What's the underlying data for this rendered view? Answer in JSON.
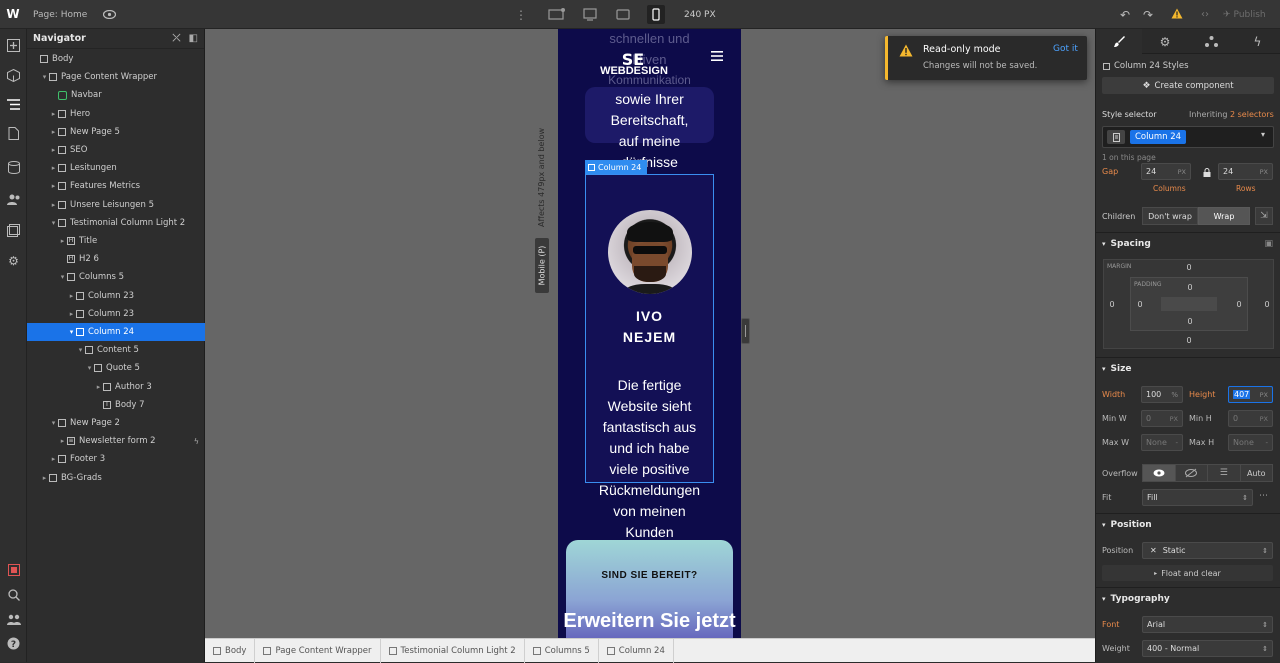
{
  "topbar": {
    "logo": "W",
    "page_label": "Page:",
    "page_name": "Home",
    "breakpoint_width": "240 PX",
    "publish_label": "Publish"
  },
  "navigator": {
    "title": "Navigator",
    "items": [
      {
        "label": "Body",
        "depth": 0,
        "arrow": "",
        "icon": "box"
      },
      {
        "label": "Page Content Wrapper",
        "depth": 1,
        "arrow": "▾",
        "icon": "box"
      },
      {
        "label": "Navbar",
        "depth": 2,
        "arrow": "",
        "icon": "symbol"
      },
      {
        "label": "Hero",
        "depth": 2,
        "arrow": "▸",
        "icon": "box"
      },
      {
        "label": "New Page 5",
        "depth": 2,
        "arrow": "▸",
        "icon": "box"
      },
      {
        "label": "SEO",
        "depth": 2,
        "arrow": "▸",
        "icon": "box"
      },
      {
        "label": "Lesitungen",
        "depth": 2,
        "arrow": "▸",
        "icon": "box"
      },
      {
        "label": "Features Metrics",
        "depth": 2,
        "arrow": "▸",
        "icon": "box"
      },
      {
        "label": "Unsere Leisungen 5",
        "depth": 2,
        "arrow": "▸",
        "icon": "box"
      },
      {
        "label": "Testimonial Column Light 2",
        "depth": 2,
        "arrow": "▾",
        "icon": "box"
      },
      {
        "label": "Title",
        "depth": 3,
        "arrow": "▸",
        "icon": "heading"
      },
      {
        "label": "H2 6",
        "depth": 3,
        "arrow": "",
        "icon": "heading"
      },
      {
        "label": "Columns 5",
        "depth": 3,
        "arrow": "▾",
        "icon": "box"
      },
      {
        "label": "Column 23",
        "depth": 4,
        "arrow": "▸",
        "icon": "box"
      },
      {
        "label": "Column 23",
        "depth": 4,
        "arrow": "▸",
        "icon": "box"
      },
      {
        "label": "Column 24",
        "depth": 4,
        "arrow": "▾",
        "icon": "box"
      },
      {
        "label": "Content 5",
        "depth": 5,
        "arrow": "▾",
        "icon": "box"
      },
      {
        "label": "Quote 5",
        "depth": 6,
        "arrow": "▾",
        "icon": "box"
      },
      {
        "label": "Author 3",
        "depth": 7,
        "arrow": "▸",
        "icon": "box"
      },
      {
        "label": "Body 7",
        "depth": 7,
        "arrow": "",
        "icon": "text"
      },
      {
        "label": "New Page 2",
        "depth": 2,
        "arrow": "▾",
        "icon": "box"
      },
      {
        "label": "Newsletter form 2",
        "depth": 3,
        "arrow": "▸",
        "icon": "form"
      },
      {
        "label": "Footer 3",
        "depth": 2,
        "arrow": "▸",
        "icon": "box"
      },
      {
        "label": "BG-Grads",
        "depth": 1,
        "arrow": "▸",
        "icon": "box"
      }
    ]
  },
  "canvas": {
    "breakpoint_affects": "Affects 479px and below",
    "breakpoint_name": "Mobile (P)",
    "site": {
      "text_top1": "schnellen und",
      "text_top2": "ktiven",
      "text_top3": "Kommunikation",
      "logo_text": "WEBDESIGN",
      "card_lines": [
        "sowie Ihrer",
        "Bereitschaft,",
        "auf meine"
      ],
      "card_partial": "dürfnisse",
      "selected_label": "Column 24",
      "author_name_1": "IVO",
      "author_name_2": "NEJEM",
      "quote_lines": [
        "Die fertige",
        "Website sieht",
        "fantastisch aus",
        "und ich habe",
        "viele positive",
        "Rückmeldungen",
        "von meinen",
        "Kunden"
      ],
      "cta_label": "SIND SIE BEREIT?",
      "cta_headline": "Erweitern Sie jetzt"
    }
  },
  "toast": {
    "title": "Read-only mode",
    "message": "Changes will not be saved.",
    "action": "Got it"
  },
  "breadcrumb": [
    "Body",
    "Page Content Wrapper",
    "Testimonial Column Light 2",
    "Columns 5",
    "Column 24"
  ],
  "style_panel": {
    "element_title": "Column 24 Styles",
    "create_component": "Create component",
    "style_selector_label": "Style selector",
    "inheriting_label": "Inheriting",
    "inheriting_link": "2 selectors",
    "selector_tag": "Column 24",
    "on_page": "1 on this page",
    "gap_label": "Gap",
    "gap_columns": "24",
    "gap_rows": "24",
    "gap_unit": "PX",
    "columns_label": "Columns",
    "rows_label": "Rows",
    "children_label": "Children",
    "dont_wrap": "Don't wrap",
    "wrap": "Wrap",
    "spacing_title": "Spacing",
    "margin_label": "MARGIN",
    "padding_label": "PADDING",
    "margin_top": "0",
    "margin_right": "0",
    "margin_bottom": "0",
    "margin_left": "0",
    "padding_top": "0",
    "padding_right": "0",
    "padding_bottom": "0",
    "padding_left": "0",
    "size_title": "Size",
    "width_label": "Width",
    "width_value": "100",
    "width_unit": "%",
    "height_label": "Height",
    "height_value": "407",
    "height_unit": "PX",
    "min_w_label": "Min W",
    "min_w_value": "0",
    "min_h_label": "Min H",
    "min_h_value": "0",
    "max_w_label": "Max W",
    "max_w_value": "None",
    "max_h_label": "Max H",
    "max_h_value": "None",
    "px": "PX",
    "dash": "-",
    "overflow_label": "Overflow",
    "overflow_auto": "Auto",
    "fit_label": "Fit",
    "fit_value": "Fill",
    "position_title": "Position",
    "position_label": "Position",
    "position_value": "Static",
    "float_clear": "Float and clear",
    "typography_title": "Typography",
    "font_label": "Font",
    "font_value": "Arial",
    "weight_label": "Weight",
    "weight_value": "400 - Normal"
  },
  "colors": {
    "accent": "#1a73e8",
    "site_bg": "#0d0b4a",
    "warning": "#f5b82e",
    "orange_label": "#e88a4b"
  }
}
